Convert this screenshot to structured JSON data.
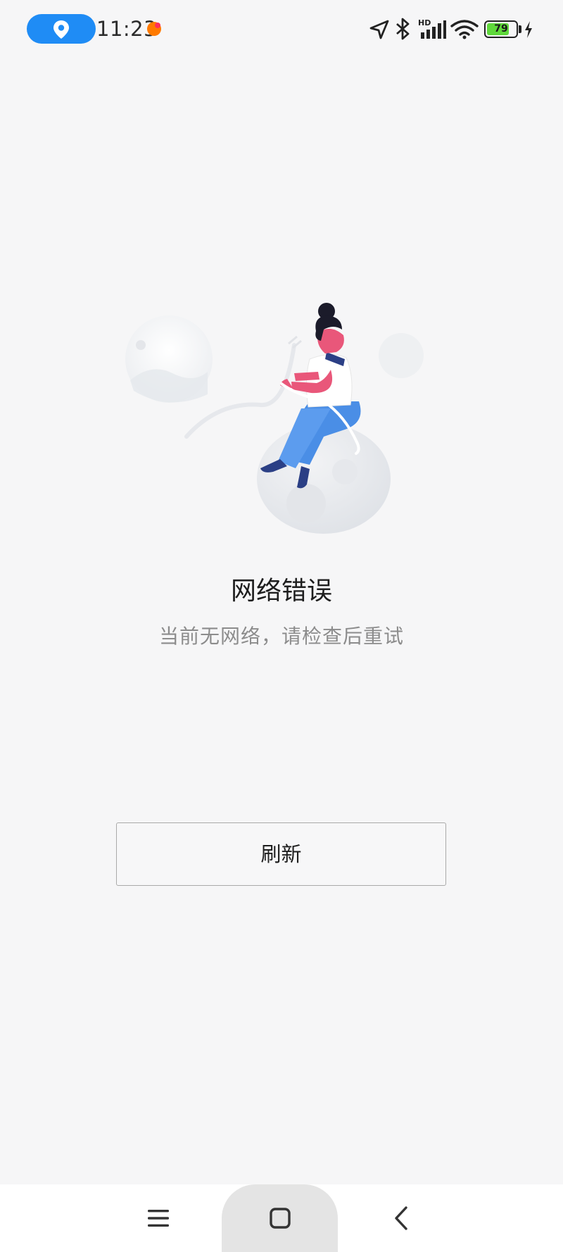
{
  "status_bar": {
    "time": "11:23",
    "battery_level": 79,
    "battery_label": "79",
    "network_badge": "HD",
    "icons": [
      "location-pin-icon",
      "notification-dot-icon",
      "navigation-arrow-icon",
      "bluetooth-icon",
      "signal-icon",
      "wifi-icon",
      "battery-icon",
      "charging-icon"
    ],
    "colors": {
      "location_pill": "#1f8cf5",
      "battery_fill": "#5fd93b",
      "notif_dot": "#ff7a00"
    }
  },
  "error": {
    "title": "网络错误",
    "description": "当前无网络，请检查后重试"
  },
  "actions": {
    "refresh_label": "刷新"
  },
  "nav_bar": {
    "icons": [
      "menu-icon",
      "home-square-icon",
      "back-chevron-icon"
    ]
  },
  "colors": {
    "background": "#f6f6f7",
    "illustration_pink": "#e9577a",
    "illustration_blue": "#4a8ee6",
    "illustration_navy": "#2b3f85"
  }
}
